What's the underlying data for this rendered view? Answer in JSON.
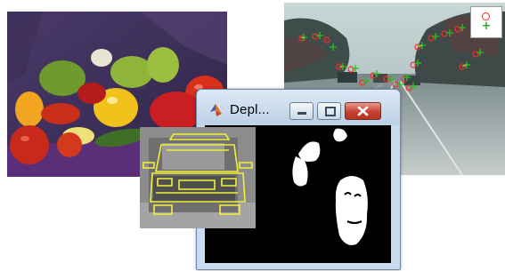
{
  "window": {
    "title": "Depl...",
    "controls": {
      "minimize_icon": "minimize-icon",
      "maximize_icon": "maximize-icon",
      "close_icon": "close-icon"
    },
    "app_icon": "matlab-icon"
  },
  "images": [
    {
      "name": "peppers-photo"
    },
    {
      "name": "street-feature-tracking-image"
    },
    {
      "name": "car-edge-detection-image"
    },
    {
      "name": "blob-detection-image"
    }
  ],
  "colors": {
    "titlebar": "#c9dbee",
    "close_button": "#c8402f",
    "feature_circle": "#ff2a2a",
    "feature_plus": "#23b323",
    "edge_overlay": "#f2f03a"
  }
}
